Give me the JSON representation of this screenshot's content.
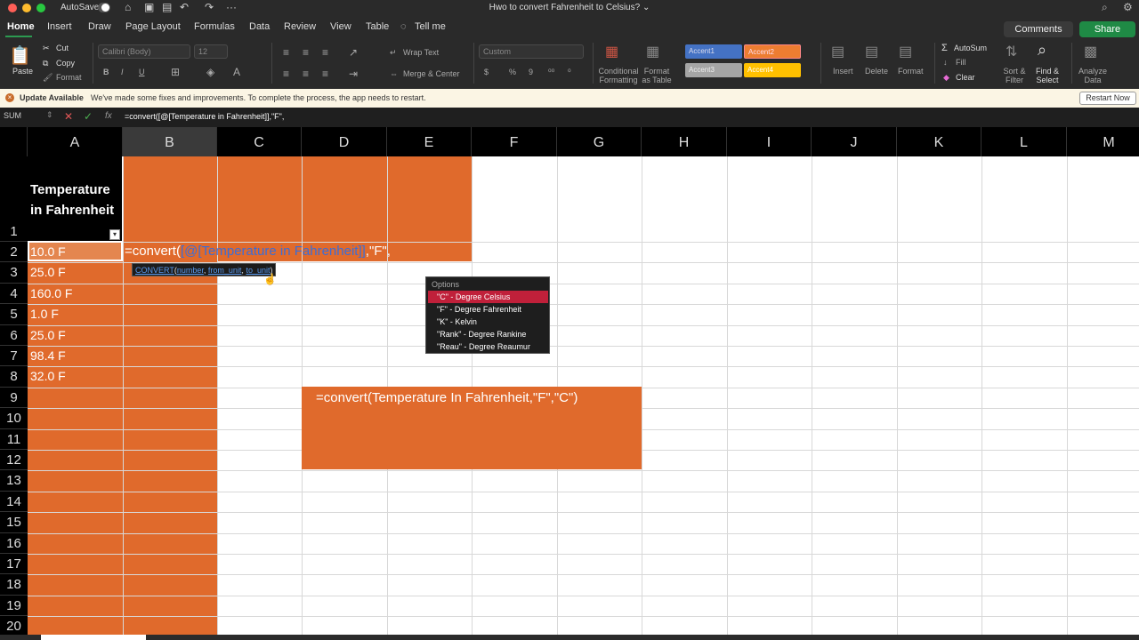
{
  "titlebar": {
    "autosave_label": "AutoSave",
    "doc_title": "Hwo to convert Fahrenheit to Celsius? ⌄"
  },
  "tabs": [
    "Home",
    "Insert",
    "Draw",
    "Page Layout",
    "Formulas",
    "Data",
    "Review",
    "View",
    "Table"
  ],
  "tell_me": "Tell me",
  "actions": {
    "comments": "Comments",
    "share": "Share"
  },
  "ribbon": {
    "paste": "Paste",
    "cut": "Cut",
    "copy": "Copy",
    "format": "Format",
    "font_name": "Calibri (Body)",
    "font_size": "12",
    "wrap_text": "Wrap Text",
    "merge_center": "Merge & Center",
    "number_format": "Custom",
    "conditional_formatting": "Conditional Formatting",
    "format_as_table": "Format as Table",
    "accent1": "Accent1",
    "accent2": "Accent2",
    "accent3": "Accent3",
    "accent4": "Accent4",
    "insert": "Insert",
    "delete": "Delete",
    "format_cells": "Format",
    "autosum": "AutoSum",
    "fill": "Fill",
    "clear": "Clear",
    "sort_filter": "Sort & Filter",
    "find_select": "Find & Select",
    "analyze_data": "Analyze Data"
  },
  "update": {
    "title": "Update Available",
    "message": "We've made some fixes and improvements. To complete the process, the app needs to restart.",
    "button": "Restart Now"
  },
  "formula_bar": {
    "name_box": "SUM",
    "fx": "fx",
    "formula": "=convert([@[Temperature in Fahrenheit]],\"F\","
  },
  "columns": [
    "A",
    "B",
    "C",
    "D",
    "E",
    "F",
    "G",
    "H",
    "I",
    "J",
    "K",
    "L",
    "M"
  ],
  "rows": [
    "1",
    "2",
    "3",
    "4",
    "5",
    "6",
    "7",
    "8",
    "9",
    "10",
    "11",
    "12",
    "13",
    "14",
    "15",
    "16",
    "17",
    "18",
    "19",
    "20"
  ],
  "header_line1": "Temperature",
  "header_line2": "in Fahrenheit",
  "values": [
    "10.0 F",
    "25.0 F",
    "160.0 F",
    "1.0 F",
    "25.0 F",
    "98.4 F",
    "32.0 F"
  ],
  "editing": {
    "prefix": "=convert(",
    "ref": "[@[Temperature in Fahrenheit]]",
    "suffix": ",\"F\","
  },
  "tooltip": {
    "fn": "CONVERT",
    "arg1": "number",
    "arg2": "from_unit",
    "arg3": "to_unit"
  },
  "options": {
    "title": "Options",
    "items": [
      "\"C\" - Degree Celsius",
      "\"F\" - Degree Fahrenheit",
      "\"K\" - Kelvin",
      "\"Rank\" - Degree Rankine",
      "\"Reau\" - Degree Reaumur"
    ]
  },
  "note": "=convert(Temperature In Fahrenheit,\"F\",\"C\")"
}
